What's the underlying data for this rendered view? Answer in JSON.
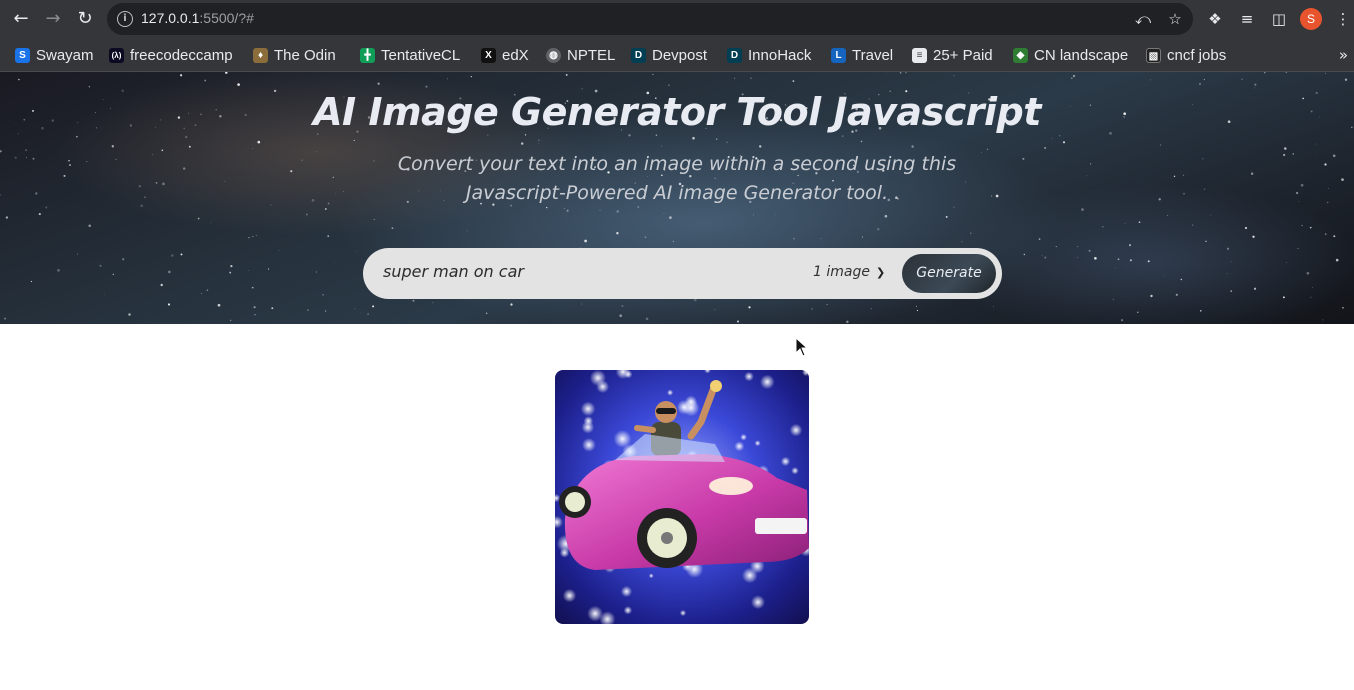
{
  "browser": {
    "url_host": "127.0.0.1",
    "url_path": ":5500/?#",
    "profile_initial": "S"
  },
  "bookmarks": [
    {
      "label": "Swayam",
      "icon": "swayam-icon",
      "color": "#1a73e8",
      "glyph": "S"
    },
    {
      "label": "freecodeccamp",
      "icon": "freecodecamp-icon",
      "color": "#0a0a23",
      "glyph": "(ʌ)"
    },
    {
      "label": "The Odin",
      "icon": "odin-icon",
      "color": "#8a6d3b",
      "glyph": "♦"
    },
    {
      "label": "TentativeCL",
      "icon": "sheets-icon",
      "color": "#0f9d58",
      "glyph": "╋"
    },
    {
      "label": "edX",
      "icon": "edx-icon",
      "color": "#111111",
      "glyph": "X"
    },
    {
      "label": "NPTEL",
      "icon": "globe-icon",
      "color": "#5f6368",
      "glyph": "◍"
    },
    {
      "label": "Devpost",
      "icon": "devpost-icon",
      "color": "#003e54",
      "glyph": "D"
    },
    {
      "label": "InnoHack",
      "icon": "devpost-icon",
      "color": "#003e54",
      "glyph": "D"
    },
    {
      "label": "Travel",
      "icon": "travel-icon",
      "color": "#1565c0",
      "glyph": "L"
    },
    {
      "label": "25+ Paid",
      "icon": "doc-icon",
      "color": "#e8eaed",
      "glyph": "≡"
    },
    {
      "label": "CN landscape",
      "icon": "cncf-icon",
      "color": "#2e7d32",
      "glyph": "◆"
    },
    {
      "label": "cncf jobs",
      "icon": "cncf-jobs-icon",
      "color": "#222222",
      "glyph": "▧"
    }
  ],
  "hero": {
    "title": "AI Image Generator Tool Javascript",
    "subtitle": "Convert your text into an image within a second using this Javascript-Powered AI image Generator tool."
  },
  "form": {
    "prompt_value": "super man on car",
    "image_count": "1 image",
    "generate_label": "Generate"
  },
  "result": {
    "image_alt": "superman-on-pink-car-generated-image"
  }
}
